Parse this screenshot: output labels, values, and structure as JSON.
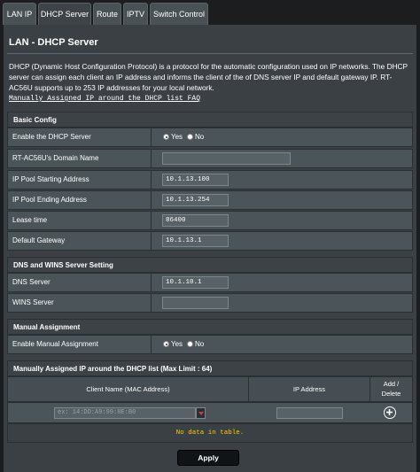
{
  "tabs": [
    {
      "label": "LAN IP"
    },
    {
      "label": "DHCP Server"
    },
    {
      "label": "Route"
    },
    {
      "label": "IPTV"
    },
    {
      "label": "Switch Control"
    }
  ],
  "page_title": "LAN - DHCP Server",
  "description": "DHCP (Dynamic Host Configuration Protocol) is a protocol for the automatic configuration used on IP networks. The DHCP server can assign each client an IP address and informs the client of the of DNS server IP and default gateway IP. RT-AC56U supports up to 253 IP addresses for your local network.",
  "faq_link": "Manually Assigned IP around the DHCP list FAQ",
  "basic_config": {
    "header": "Basic Config",
    "enable_dhcp": {
      "label": "Enable the DHCP Server",
      "yes": "Yes",
      "no": "No"
    },
    "domain_name": {
      "label": "RT-AC56U's Domain Name",
      "value": ""
    },
    "pool_start": {
      "label": "IP Pool Starting Address",
      "value": "10.1.13.100"
    },
    "pool_end": {
      "label": "IP Pool Ending Address",
      "value": "10.1.13.254"
    },
    "lease_time": {
      "label": "Lease time",
      "value": "86400"
    },
    "default_gateway": {
      "label": "Default Gateway",
      "value": "10.1.13.1"
    }
  },
  "dns_wins": {
    "header": "DNS and WINS Server Setting",
    "dns_server": {
      "label": "DNS Server",
      "value": "10.1.10.1"
    },
    "wins_server": {
      "label": "WINS Server",
      "value": ""
    }
  },
  "manual_assignment": {
    "header": "Manual Assignment",
    "enable": {
      "label": "Enable Manual Assignment",
      "yes": "Yes",
      "no": "No"
    }
  },
  "manual_list": {
    "header": "Manually Assigned IP around the DHCP list (Max Limit : 64)",
    "col_client": "Client Name (MAC Address)",
    "col_ip": "IP Address",
    "col_add_delete": "Add / Delete",
    "mac_placeholder": "ex: 14:DD:A9:99:8E:B0",
    "ip_value": "",
    "no_data": "No data in table."
  },
  "apply_label": "Apply"
}
